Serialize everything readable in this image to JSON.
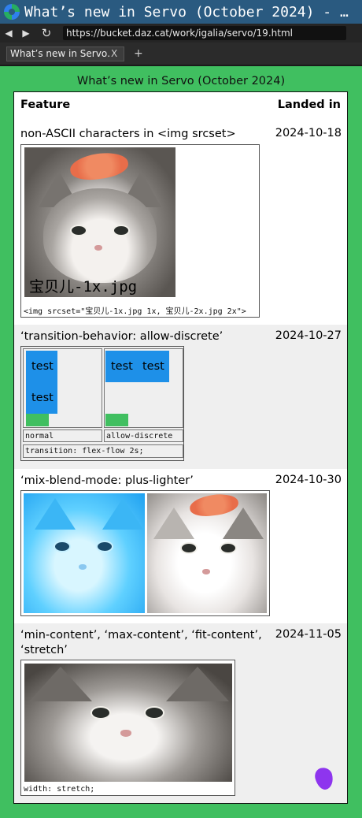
{
  "window": {
    "title": "What’s new in Servo (October 2024) - …"
  },
  "toolbar": {
    "back": "◀",
    "forward": "▶",
    "reload": "↻",
    "url": "https://bucket.daz.cat/work/igalia/servo/19.html"
  },
  "tabs": {
    "active_label": "What’s new in Servo…",
    "close": "X",
    "add": "+"
  },
  "page": {
    "heading": "What’s new in Servo (October 2024)",
    "col_feature": "Feature",
    "col_landed": "Landed in",
    "rows": [
      {
        "feature": "non-ASCII characters in <img srcset>",
        "date": "2024-10-18",
        "overlay": "宝贝儿-1x.jpg",
        "caption": "<img srcset=\"宝贝儿-1x.jpg 1x, 宝贝儿-2x.jpg 2x\">"
      },
      {
        "feature": "‘transition-behavior: allow-discrete’",
        "date": "2024-10-27",
        "test": "test",
        "cap_normal": "normal",
        "cap_discrete": "allow-discrete",
        "cap_transition": "transition: flex-flow 2s;"
      },
      {
        "feature": "‘mix-blend-mode: plus-lighter’",
        "date": "2024-10-30"
      },
      {
        "feature": "‘min-content’, ‘max-content’, ‘fit-content’, ‘stretch’",
        "date": "2024-11-05",
        "caption": "width: stretch;"
      }
    ]
  },
  "colors": {
    "page_bg": "#40bf60",
    "titlebar": "#2a5a80",
    "blue": "#1e90e8",
    "cursor": "#8e35ee"
  }
}
